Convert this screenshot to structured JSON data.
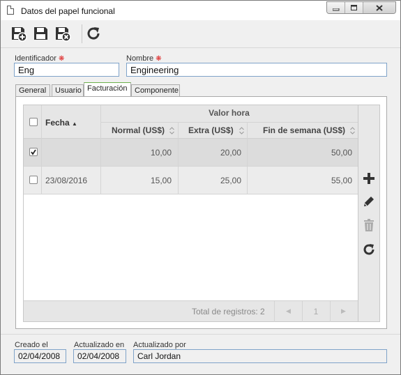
{
  "window": {
    "title": "Datos del papel funcional",
    "minimize_glyph": "▭",
    "maximize_glyph": "▢",
    "close_glyph": "✕"
  },
  "toolbar": {
    "buttons": [
      {
        "name": "save-and-new-icon"
      },
      {
        "name": "save-icon"
      },
      {
        "name": "save-and-close-icon"
      },
      {
        "name": "refresh-icon"
      }
    ]
  },
  "form": {
    "identifier_label": "Identificador",
    "identifier_value": "Eng",
    "name_label": "Nombre",
    "name_value": "Engineering",
    "required_mark": "❋"
  },
  "tabs": [
    "General",
    "Usuario",
    "Facturación",
    "Componente"
  ],
  "active_tab": "Facturación",
  "grid": {
    "col_date": "Fecha",
    "group_header": "Valor hora",
    "col_normal": "Normal (US$)",
    "col_extra": "Extra (US$)",
    "col_weekend": "Fin de semana (US$)",
    "sort_up": "▲",
    "rows": [
      {
        "checked": true,
        "date": "",
        "normal": "10,00",
        "extra": "20,00",
        "weekend": "50,00"
      },
      {
        "checked": false,
        "date": "23/08/2016",
        "normal": "15,00",
        "extra": "25,00",
        "weekend": "55,00"
      }
    ],
    "total_label": "Total de registros: 2",
    "page": "1",
    "prev_glyph": "◀",
    "next_glyph": "▶"
  },
  "side_actions": [
    {
      "name": "add-icon"
    },
    {
      "name": "edit-icon"
    },
    {
      "name": "delete-icon"
    },
    {
      "name": "refresh-icon"
    }
  ],
  "meta": {
    "created_label": "Creado el",
    "created_value": "02/04/2008",
    "updated_label": "Actualizado en",
    "updated_value": "02/04/2008",
    "updated_by_label": "Actualizado por",
    "updated_by_value": "Carl Jordan"
  },
  "colors": {
    "field_border": "#7fa3c9",
    "active_tab_accent": "#6bb04b",
    "required": "#dd2222"
  }
}
